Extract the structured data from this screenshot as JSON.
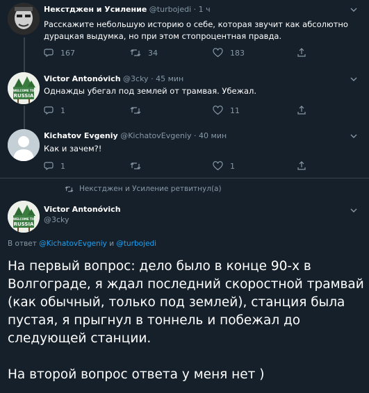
{
  "tweet1": {
    "name": "Некстджен и Усиление",
    "handle": "@turbojedi",
    "time": "· 1 ч",
    "text_line1": "Расскажите небольшую историю о себе, которая звучит как абсолютно",
    "text_line2": "дурацкая выдумка, но при этом стопроцентная правда.",
    "replies": "167",
    "retweets": "34",
    "likes": "183"
  },
  "tweet2": {
    "name": "Victor Antonóvich",
    "handle": "@3cky",
    "time": "· 45 мин",
    "text": "Однажды убегал под землей от трамвая. Убежал.",
    "replies": "1",
    "likes": "11"
  },
  "tweet3": {
    "name": "Kichatov Evgeniy",
    "handle": "@KichatovEvgeniy",
    "time": "· 40 мин",
    "text": "Как и зачем?!",
    "replies": "1",
    "likes": "1"
  },
  "retweet_notice": "Некстджен и Усиление ретвитнул(а)",
  "main": {
    "name": "Victor Antonóvich",
    "handle": "@3cky",
    "reply_prefix": "В ответ",
    "reply_to1": "@KichatovEvgeniy",
    "reply_and": "и",
    "reply_to2": "@turbojedi",
    "body_l1": "На первый вопрос: дело было в конце 90-х в",
    "body_l2": "Волгограде, я ждал последний скоростной трамвай",
    "body_l3": "(как обычный, только под землей), станция была",
    "body_l4": "пустая, я прыгнул в тоннель и побежал до",
    "body_l5": "следующей станции.",
    "body_l6": "На второй вопрос ответа у меня нет )"
  },
  "avatar_sign": {
    "line1": "WELCOME TO",
    "line2": "RUSSIA"
  },
  "colors": {
    "background": "#15202b",
    "secondary_text": "#8899a6",
    "link": "#1da1f2",
    "separator": "#38444d"
  }
}
